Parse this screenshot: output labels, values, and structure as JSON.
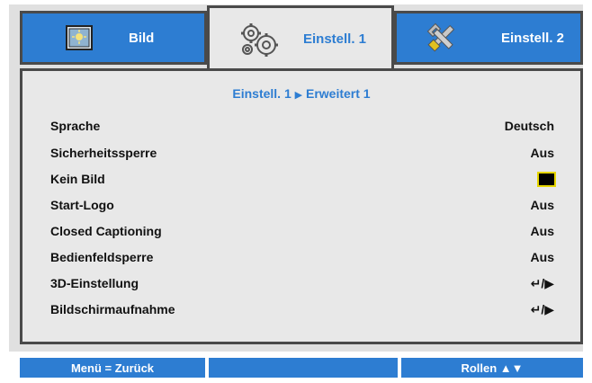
{
  "tabs": [
    {
      "label": "Bild",
      "icon": "picture-icon"
    },
    {
      "label": "Einstell. 1",
      "icon": "gears-icon"
    },
    {
      "label": "Einstell. 2",
      "icon": "tools-icon"
    }
  ],
  "breadcrumb": {
    "parent": "Einstell. 1",
    "separator": "▶",
    "current": "Erweitert 1"
  },
  "rows": [
    {
      "label": "Sprache",
      "value": "Deutsch"
    },
    {
      "label": "Sicherheitssperre",
      "value": "Aus"
    },
    {
      "label": "Kein Bild",
      "value": ""
    },
    {
      "label": "Start-Logo",
      "value": "Aus"
    },
    {
      "label": "Closed Captioning",
      "value": "Aus"
    },
    {
      "label": "Bedienfeldsperre",
      "value": "Aus"
    },
    {
      "label": "3D-Einstellung",
      "value": "↵/▶"
    },
    {
      "label": "Bildschirmaufnahme",
      "value": "↵/▶"
    }
  ],
  "footer": {
    "left": "Menü = Zurück",
    "middle": "",
    "right": "Rollen ▲▼"
  },
  "colors": {
    "accent": "#2d7dd2",
    "border": "#4a4a4a",
    "panel": "#e8e8e8",
    "swatch": "#000000"
  }
}
